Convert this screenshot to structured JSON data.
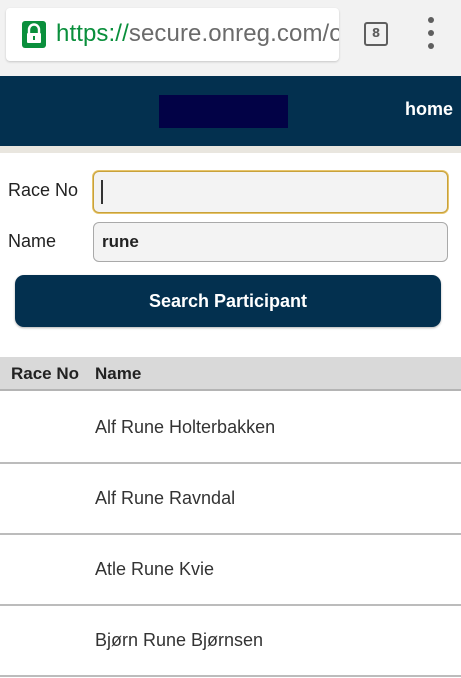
{
  "browser": {
    "url_scheme": "https://",
    "url_rest": "secure.onreg.com/o",
    "tab_count": "8",
    "accent_color": "#0a8f3c"
  },
  "header": {
    "home_label": "home",
    "brand_color": "#03304f"
  },
  "form": {
    "race_no_label": "Race No",
    "race_no_value": "",
    "name_label": "Name",
    "name_value": "rune",
    "search_button_label": "Search Participant"
  },
  "results": {
    "columns": [
      "Race No",
      "Name"
    ],
    "rows": [
      {
        "race_no": "",
        "name": "Alf Rune Holterbakken"
      },
      {
        "race_no": "",
        "name": "Alf Rune Ravndal"
      },
      {
        "race_no": "",
        "name": "Atle Rune Kvie"
      },
      {
        "race_no": "",
        "name": "Bjørn Rune Bjørnsen"
      }
    ]
  }
}
